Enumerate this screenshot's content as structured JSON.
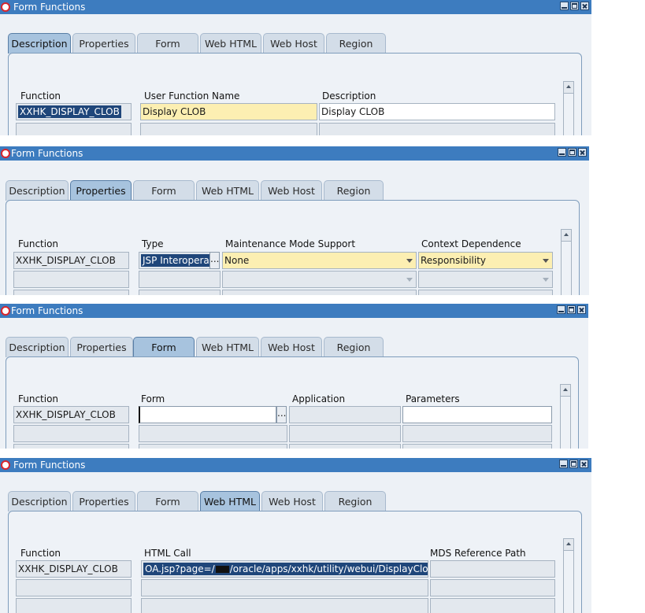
{
  "window_title": "Form Functions",
  "tabs": [
    "Description",
    "Properties",
    "Form",
    "Web HTML",
    "Web Host",
    "Region"
  ],
  "screens": [
    {
      "active_tab": "Description",
      "columns": [
        {
          "label": "Function",
          "value": "XXHK_DISPLAY_CLOB"
        },
        {
          "label": "User Function Name",
          "value": "Display CLOB"
        },
        {
          "label": "Description",
          "value": "Display CLOB"
        }
      ]
    },
    {
      "active_tab": "Properties",
      "columns": [
        {
          "label": "Function",
          "value": "XXHK_DISPLAY_CLOB"
        },
        {
          "label": "Type",
          "value": "JSP Interoperal"
        },
        {
          "label": "Maintenance Mode Support",
          "value": "None"
        },
        {
          "label": "Context Dependence",
          "value": "Responsibility"
        }
      ]
    },
    {
      "active_tab": "Form",
      "columns": [
        {
          "label": "Function",
          "value": "XXHK_DISPLAY_CLOB"
        },
        {
          "label": "Form",
          "value": ""
        },
        {
          "label": "Application",
          "value": ""
        },
        {
          "label": "Parameters",
          "value": ""
        }
      ]
    },
    {
      "active_tab": "Web HTML",
      "columns": [
        {
          "label": "Function",
          "value": "XXHK_DISPLAY_CLOB"
        },
        {
          "label": "HTML Call",
          "value_prefix": "OA.jsp?page=/",
          "value_suffix": "/oracle/apps/xxhk/utility/webui/DisplayClobP"
        },
        {
          "label": "MDS Reference Path",
          "value": ""
        }
      ]
    }
  ],
  "lov_button_label": "...",
  "colors": {
    "title_bar": "#3d7cbf",
    "active_tab": "#a7c3de",
    "required_field": "#fcefb2",
    "selection": "#1f467a"
  }
}
